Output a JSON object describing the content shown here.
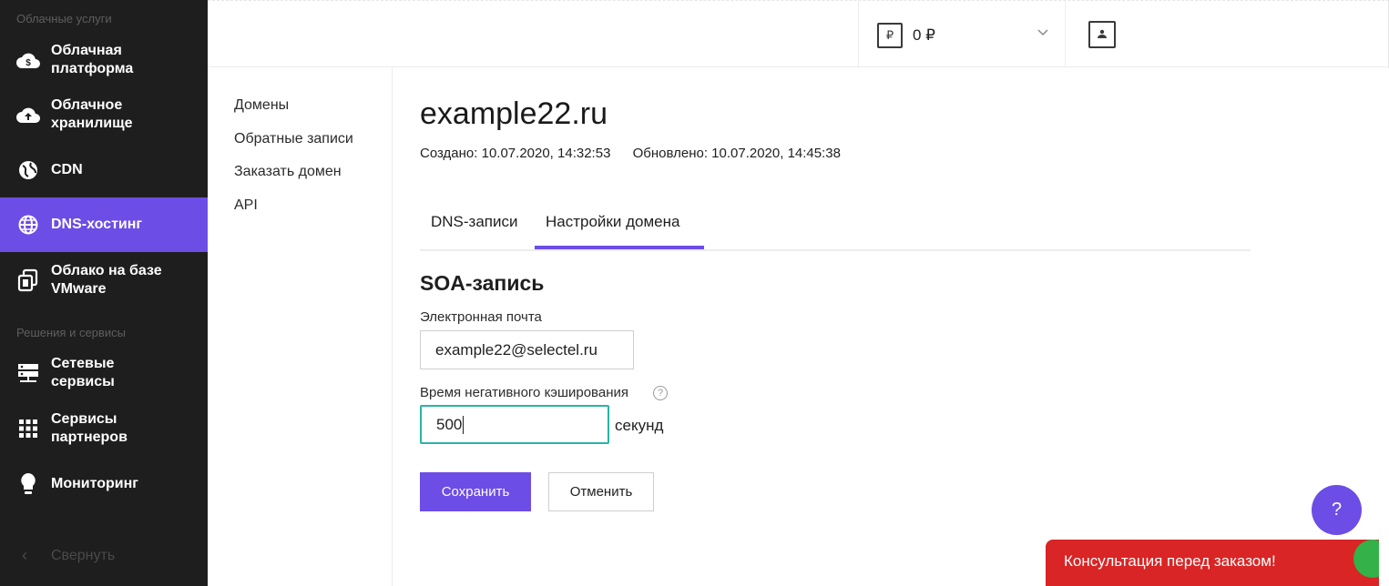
{
  "sidebar": {
    "section_cloud": "Облачные услуги",
    "section_solutions": "Решения и сервисы",
    "items": [
      {
        "label": "Облачная\nплатформа",
        "icon": "cloud-dollar-icon"
      },
      {
        "label": "Облачное\nхранилище",
        "icon": "cloud-upload-icon"
      },
      {
        "label": "CDN",
        "icon": "globe-icon"
      },
      {
        "label": "DNS-хостинг",
        "icon": "globe-grid-icon"
      },
      {
        "label": "Облако на базе\nVMware",
        "icon": "copy-window-icon"
      },
      {
        "label": "Сетевые\nсервисы",
        "icon": "server-stack-icon"
      },
      {
        "label": "Сервисы\nпартнеров",
        "icon": "grid-apps-icon"
      },
      {
        "label": "Мониторинг",
        "icon": "lightbulb-icon"
      }
    ],
    "active_item": "DNS-хостинг",
    "collapse_label": "Свернуть"
  },
  "header": {
    "currency_symbol": "₽",
    "balance": "0 ₽"
  },
  "subnav": {
    "items": [
      "Домены",
      "Обратные записи",
      "Заказать домен",
      "API"
    ]
  },
  "main": {
    "title": "example22.ru",
    "created": "Создано: 10.07.2020, 14:32:53",
    "updated": "Обновлено: 10.07.2020, 14:45:38",
    "tabs": [
      "DNS-записи",
      "Настройки домена"
    ],
    "active_tab": "Настройки домена",
    "section_title": "SOA-запись",
    "email_label": "Электронная почта",
    "email_value": "example22@selectel.ru",
    "neg_cache_label": "Время негативного кэширования",
    "neg_cache_value": "500",
    "neg_cache_unit": "секунд",
    "save_label": "Сохранить",
    "cancel_label": "Отменить"
  },
  "floating": {
    "help_label": "?",
    "consult_label": "Консультация перед заказом!"
  },
  "colors": {
    "accent": "#6c4de6",
    "sidebar_bg": "#1e1e1e",
    "focus_border": "#2bb3a4",
    "consult_bg": "#d92525"
  }
}
